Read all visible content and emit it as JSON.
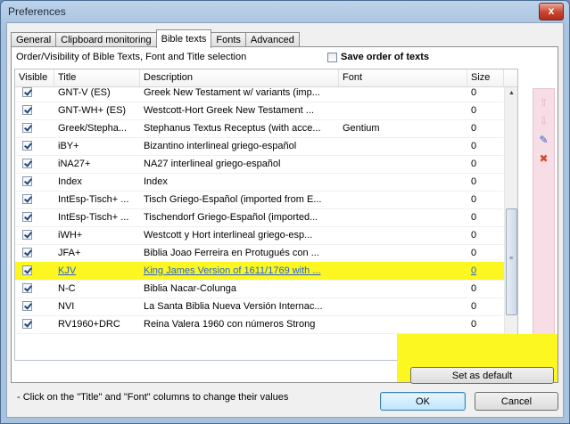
{
  "window": {
    "title": "Preferences",
    "close_glyph": "x"
  },
  "tabs": [
    {
      "label": "General"
    },
    {
      "label": "Clipboard monitoring"
    },
    {
      "label": "Bible texts",
      "active": true
    },
    {
      "label": "Fonts"
    },
    {
      "label": "Advanced"
    }
  ],
  "panel": {
    "caption": "Order/Visibility of Bible Texts, Font and Title selection",
    "save_order_label": "Save order of texts",
    "save_order_checked": false,
    "hint": "- Click on the \"Title\" and \"Font\" columns to change their values",
    "set_default_label": "Set as default"
  },
  "grid": {
    "columns": {
      "visible": "Visible",
      "title": "Title",
      "description": "Description",
      "font": "Font",
      "size": "Size"
    },
    "rows": [
      {
        "visible": true,
        "title": "GNT-V (ES)",
        "description": "Greek New Testament w/ variants (imp...",
        "font": "",
        "size": "0"
      },
      {
        "visible": true,
        "title": "GNT-WH+ (ES)",
        "description": "Westcott-Hort Greek New Testament ...",
        "font": "",
        "size": "0"
      },
      {
        "visible": true,
        "title": "Greek/Stepha...",
        "description": "Stephanus Textus Receptus (with acce...",
        "font": "Gentium",
        "size": "0"
      },
      {
        "visible": true,
        "title": "iBY+",
        "description": "Bizantino interlineal griego-español",
        "font": "",
        "size": "0"
      },
      {
        "visible": true,
        "title": "iNA27+",
        "description": "NA27 interlineal griego-español",
        "font": "",
        "size": "0"
      },
      {
        "visible": true,
        "title": "Index",
        "description": "Index",
        "font": "",
        "size": "0"
      },
      {
        "visible": true,
        "title": "IntEsp-Tisch+ ...",
        "description": "Tisch Griego-Español (imported from E...",
        "font": "",
        "size": "0"
      },
      {
        "visible": true,
        "title": "IntEsp-Tisch+ ...",
        "description": "Tischendorf Griego-Español (imported...",
        "font": "",
        "size": "0"
      },
      {
        "visible": true,
        "title": "iWH+",
        "description": "Westcott y Hort interlineal griego-esp...",
        "font": "",
        "size": "0"
      },
      {
        "visible": true,
        "title": "JFA+",
        "description": "Biblia Joao Ferreira en Protugués con ...",
        "font": "",
        "size": "0"
      },
      {
        "visible": true,
        "title": "KJV",
        "description": "King James Version of 1611/1769 with ...",
        "font": "",
        "size": "0",
        "highlighted": true
      },
      {
        "visible": true,
        "title": "N-C",
        "description": "Biblia Nacar-Colunga",
        "font": "",
        "size": "0"
      },
      {
        "visible": true,
        "title": "NVI",
        "description": "La Santa Biblia Nueva Versión Internac...",
        "font": "",
        "size": "0"
      },
      {
        "visible": true,
        "title": "RV1960+DRC",
        "description": "Reina Valera 1960 con números Strong",
        "font": "",
        "size": "0"
      }
    ]
  },
  "side_toolbar": {
    "move_up_glyph": "⇧",
    "move_down_glyph": "⇩",
    "edit_glyph": "✎",
    "remove_glyph": "✖"
  },
  "scrollbar": {
    "up_glyph": "▲",
    "down_glyph": "▼"
  },
  "buttons": {
    "ok": "OK",
    "cancel": "Cancel"
  },
  "colors": {
    "highlight": "#fcf720",
    "link": "#2b61d8",
    "side_panel": "#f7dde6"
  }
}
